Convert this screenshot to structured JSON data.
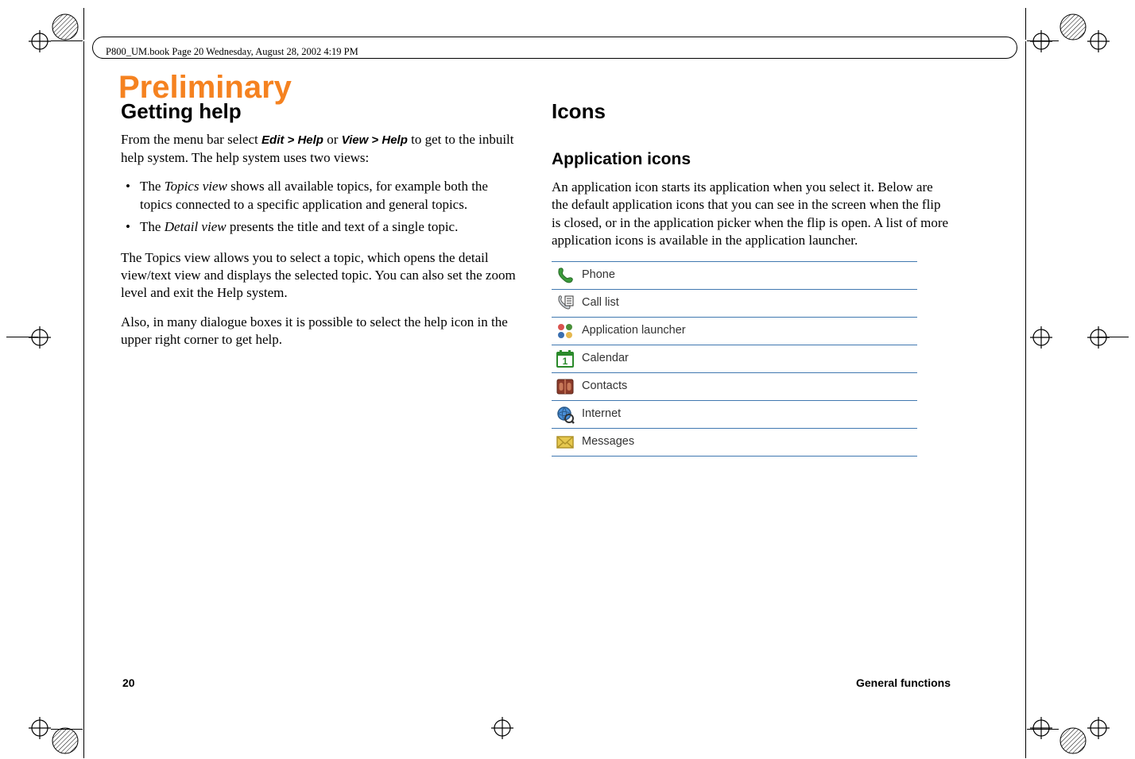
{
  "header": {
    "line": "P800_UM.book  Page 20  Wednesday, August 28, 2002  4:19 PM"
  },
  "watermark": "Preliminary",
  "left": {
    "heading": "Getting help",
    "intro_1": "From the menu bar select ",
    "intro_bold1": "Edit > Help",
    "intro_mid": " or ",
    "intro_bold2": "View > Help",
    "intro_2": " to get to the inbuilt help system. The help system uses two views:",
    "bullet1_pre": "The ",
    "bullet1_em": "Topics view",
    "bullet1_post": " shows all available topics, for example both the topics connected to a specific application and general topics.",
    "bullet2_pre": "The ",
    "bullet2_em": "Detail view",
    "bullet2_post": " presents the title and text of a single topic.",
    "para2": "The Topics view allows you to select a topic, which opens the detail view/text view and displays the selected topic. You can also set the zoom level and exit the Help system.",
    "para3": "Also, in many dialogue boxes it is possible to select the help icon in the upper right corner to get help."
  },
  "right": {
    "heading": "Icons",
    "subheading": "Application icons",
    "intro": "An application icon starts its application when you select it. Below are the default application icons that you can see in the screen when the flip is closed, or in the application picker when the flip is open. A list of more application icons is available in the application launcher.",
    "rows": {
      "r0": "Phone",
      "r1": "Call list",
      "r2": "Application launcher",
      "r3": "Calendar",
      "r4": "Contacts",
      "r5": "Internet",
      "r6": "Messages"
    }
  },
  "footer": {
    "page": "20",
    "section": "General functions"
  }
}
